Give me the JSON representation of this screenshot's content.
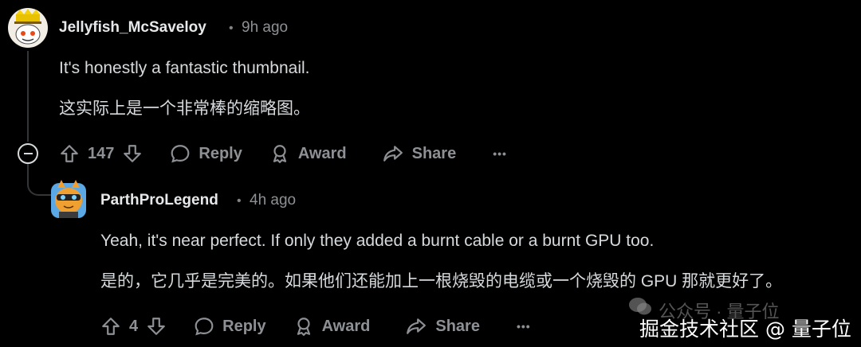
{
  "comments": [
    {
      "username": "Jellyfish_McSaveloy",
      "dot": "•",
      "time": "9h ago",
      "text_en": "It's honestly a fantastic thumbnail.",
      "text_zh": "这实际上是一个非常棒的缩略图。",
      "votes": "147",
      "reply_label": "Reply",
      "award_label": "Award",
      "share_label": "Share",
      "more_label": "•••"
    },
    {
      "username": "ParthProLegend",
      "dot": "•",
      "time": "4h ago",
      "text_en": "Yeah, it's near perfect. If only they added a burnt cable or a burnt GPU too.",
      "text_zh": "是的，它几乎是完美的。如果他们还能加上一根烧毁的电缆或一个烧毁的 GPU 那就更好了。",
      "votes": "4",
      "reply_label": "Reply",
      "award_label": "Award",
      "share_label": "Share",
      "more_label": "•••"
    }
  ],
  "watermark": {
    "faint": "公众号 · 量子位",
    "main": "掘金技术社区 @ 量子位"
  },
  "colors": {
    "background": "#000000",
    "text": "#d7dadc",
    "muted": "#8d9094",
    "thread_line": "#343536"
  }
}
